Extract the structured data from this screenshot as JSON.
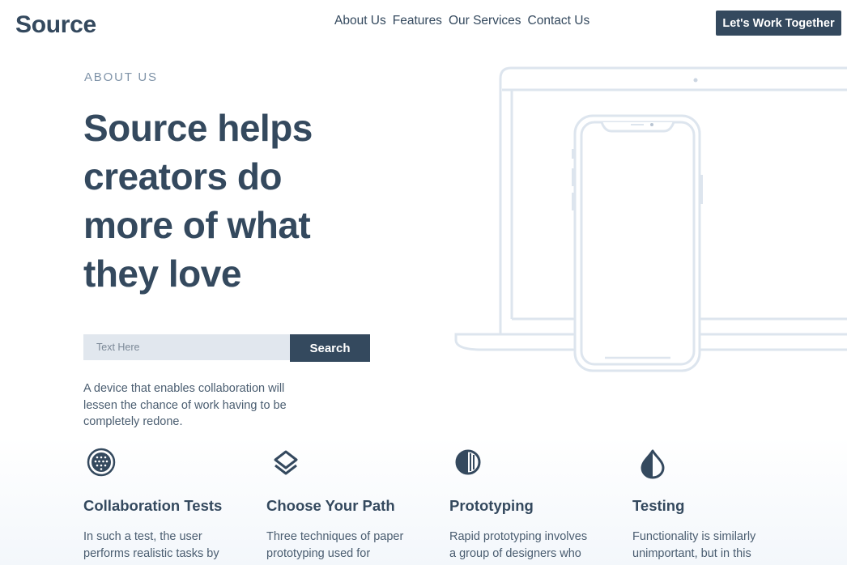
{
  "header": {
    "brand": "Source",
    "nav": [
      "About Us",
      "Features",
      "Our Services",
      "Contact Us"
    ],
    "cta_label": "Let's Work Together"
  },
  "hero": {
    "eyebrow": "ABOUT US",
    "headline": "Source helps creators do more of what they love",
    "search": {
      "placeholder": "Text Here",
      "button_label": "Search"
    },
    "description": "A device that enables collaboration will lessen the chance of work having to be completely redone."
  },
  "features": [
    {
      "icon": "globe-grid-icon",
      "title": "Collaboration Tests",
      "text": "In such a test, the user performs realistic tasks by"
    },
    {
      "icon": "layers-icon",
      "title": "Choose Your Path",
      "text": "Three techniques of paper prototyping used for usability"
    },
    {
      "icon": "half-circle-lines-icon",
      "title": "Prototyping",
      "text": "Rapid prototyping involves a group of designers who each"
    },
    {
      "icon": "drop-half-icon",
      "title": "Testing",
      "text": "Functionality is similarly unimportant, but in this case"
    }
  ],
  "colors": {
    "primary": "#34495e",
    "muted": "#7f93a8",
    "input_bg": "#e1e7ee",
    "device_outline": "#dde5ee"
  }
}
